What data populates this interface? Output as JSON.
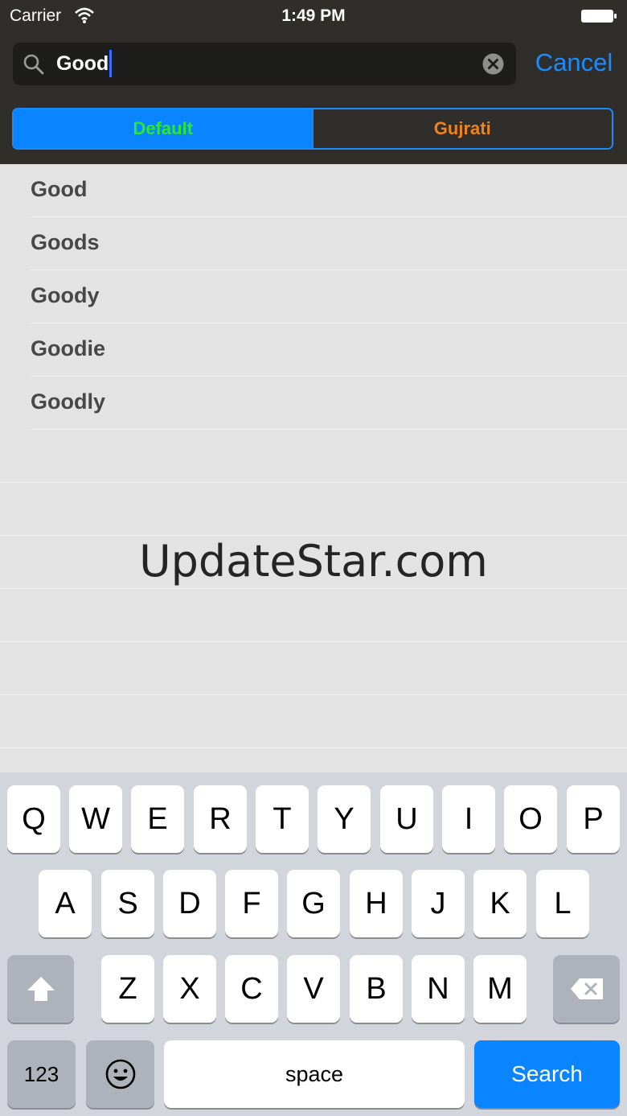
{
  "status_bar": {
    "carrier": "Carrier",
    "time": "1:49 PM"
  },
  "search": {
    "value": "Good",
    "cancel_label": "Cancel"
  },
  "segments": [
    {
      "label": "Default",
      "selected": true,
      "text_color": "#2ee62e"
    },
    {
      "label": "Gujrati",
      "selected": false,
      "text_color": "#f0841a"
    }
  ],
  "results": [
    "Good",
    "Goods",
    "Goody",
    "Goodie",
    "Goodly"
  ],
  "watermark": "UpdateStar.com",
  "keyboard": {
    "row1": [
      "Q",
      "W",
      "E",
      "R",
      "T",
      "Y",
      "U",
      "I",
      "O",
      "P"
    ],
    "row2": [
      "A",
      "S",
      "D",
      "F",
      "G",
      "H",
      "J",
      "K",
      "L"
    ],
    "row3": [
      "Z",
      "X",
      "C",
      "V",
      "B",
      "N",
      "M"
    ],
    "numbers_label": "123",
    "space_label": "space",
    "search_label": "Search"
  },
  "colors": {
    "accent": "#0a84ff",
    "header_bg": "#2f2e2b"
  }
}
